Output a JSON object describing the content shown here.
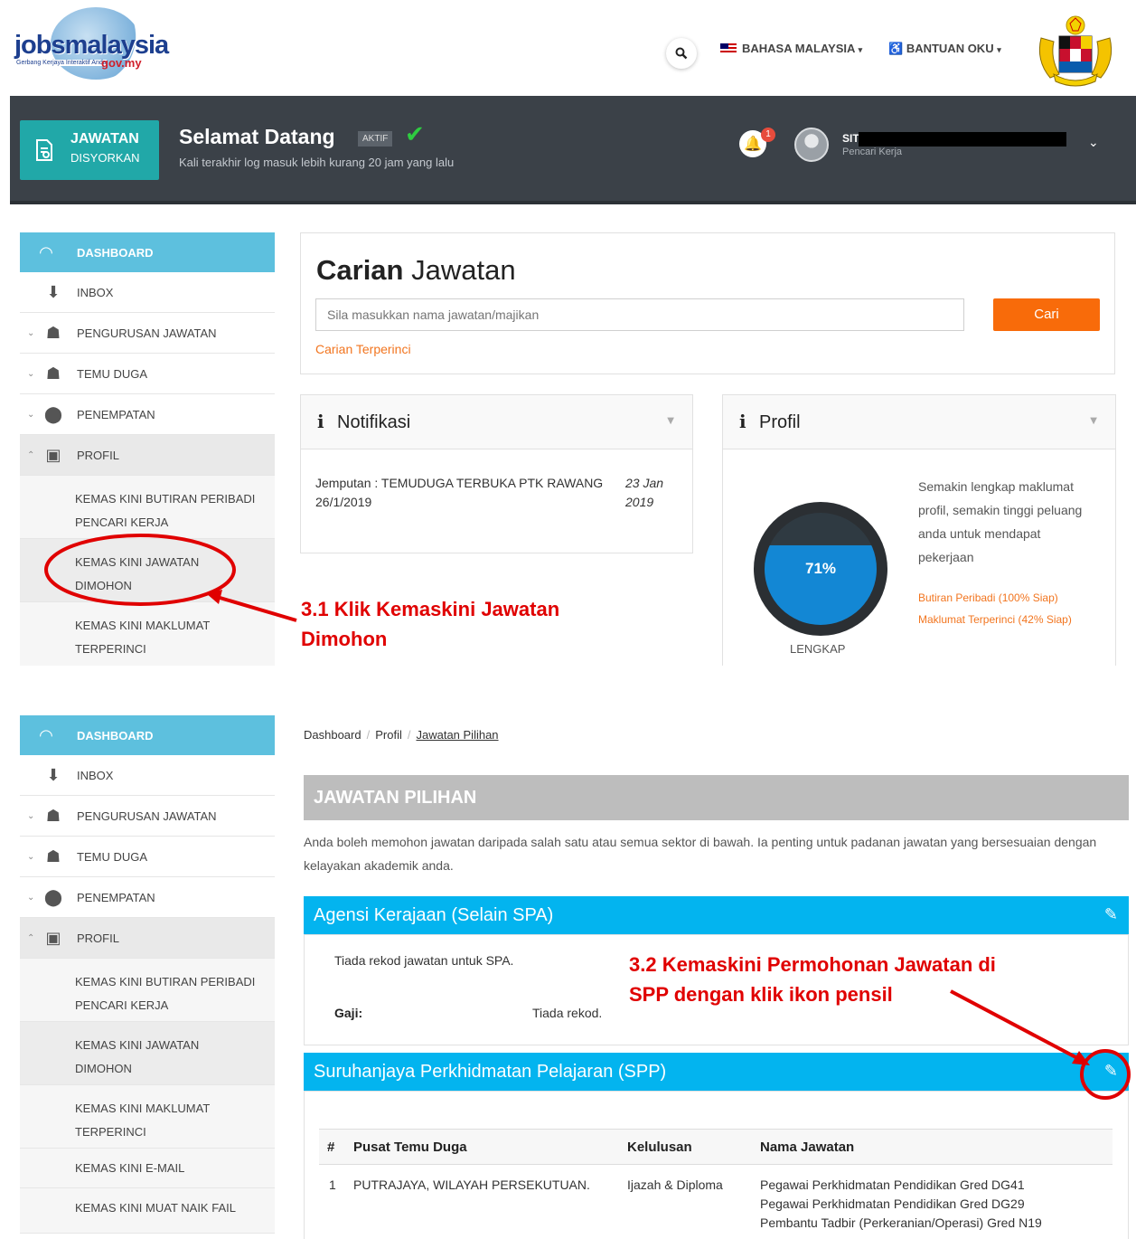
{
  "header": {
    "logo_main": "jobsmalaysia",
    "logo_tagline": "Gerbang Kerjaya Interaktif Anda",
    "logo_domain": "gov.my",
    "language": "BAHASA MALAYSIA",
    "accessibility": "BANTUAN OKU"
  },
  "welcome": {
    "jawatan_title": "JAWATAN",
    "jawatan_sub": "DISYORKAN",
    "title": "Selamat Datang",
    "badge": "AKTIF",
    "last_login": "Kali terakhir log masuk lebih kurang 20 jam yang lalu",
    "notifications_count": "1",
    "user_name": "SITI",
    "user_role": "Pencari Kerja"
  },
  "sidebar": {
    "dashboard": "DASHBOARD",
    "items": [
      {
        "label": "INBOX"
      },
      {
        "label": "PENGURUSAN JAWATAN"
      },
      {
        "label": "TEMU DUGA"
      },
      {
        "label": "PENEMPATAN"
      },
      {
        "label": "PROFIL"
      }
    ],
    "sub_items": [
      "KEMAS KINI BUTIRAN PERIBADI PENCARI KERJA",
      "KEMAS KINI JAWATAN DIMOHON",
      "KEMAS KINI MAKLUMAT TERPERINCI",
      "KEMAS KINI E-MAIL",
      "KEMAS KINI MUAT NAIK FAIL"
    ]
  },
  "search": {
    "title_bold": "Carian",
    "title_rest": "Jawatan",
    "placeholder": "Sila masukkan nama jawatan/majikan",
    "button": "Cari",
    "advanced": "Carian Terperinci"
  },
  "notifikasi": {
    "title": "Notifikasi",
    "text": "Jemputan : TEMUDUGA TERBUKA PTK RAWANG 26/1/2019",
    "date": "23 Jan 2019"
  },
  "profil": {
    "title": "Profil",
    "percent": "71%",
    "completion": 0.71,
    "label": "LENGKAP",
    "text": "Semakin lengkap maklumat profil, semakin tinggi peluang anda untuk mendapat pekerjaan",
    "stat1": "Butiran Peribadi (100% Siap)",
    "stat2": "Maklumat Terperinci (42% Siap)"
  },
  "annotations": {
    "a1_line1": "3.1  Klik Kemaskini Jawatan",
    "a1_line2": "Dimohon",
    "a2_line1": "3.2 Kemaskini Permohonan Jawatan di",
    "a2_line2": "SPP dengan klik ikon pensil",
    "color": "#e00000"
  },
  "breadcrumb": {
    "items": [
      "Dashboard",
      "Profil",
      "Jawatan Pilihan"
    ]
  },
  "pilihan": {
    "title": "JAWATAN PILIHAN",
    "description": "Anda boleh memohon jawatan daripada salah satu atau semua sektor di bawah. Ia penting untuk padanan jawatan yang bersesuaian dengan kelayakan akademik anda.",
    "sector1": {
      "title": "Agensi Kerajaan (Selain SPA)",
      "empty": "Tiada rekod jawatan untuk SPA.",
      "gaji_label": "Gaji:",
      "gaji_value": "Tiada rekod."
    },
    "sector2": {
      "title": "Suruhanjaya Perkhidmatan Pelajaran (SPP)",
      "columns": [
        "#",
        "Pusat Temu Duga",
        "Kelulusan",
        "Nama Jawatan"
      ],
      "row": {
        "no": "1",
        "pusat": "PUTRAJAYA, WILAYAH PERSEKUTUAN.",
        "kelulusan": "Ijazah & Diploma",
        "jawatan": [
          "Pegawai Perkhidmatan Pendidikan Gred DG41",
          "Pegawai Perkhidmatan Pendidikan Gred DG29",
          "Pembantu Tadbir (Perkeranian/Operasi) Gred N19"
        ]
      }
    }
  },
  "colors": {
    "sky": "#03b4ef",
    "teal": "#21a8a8",
    "orange": "#f86b0a",
    "dark": "#3b4148"
  }
}
